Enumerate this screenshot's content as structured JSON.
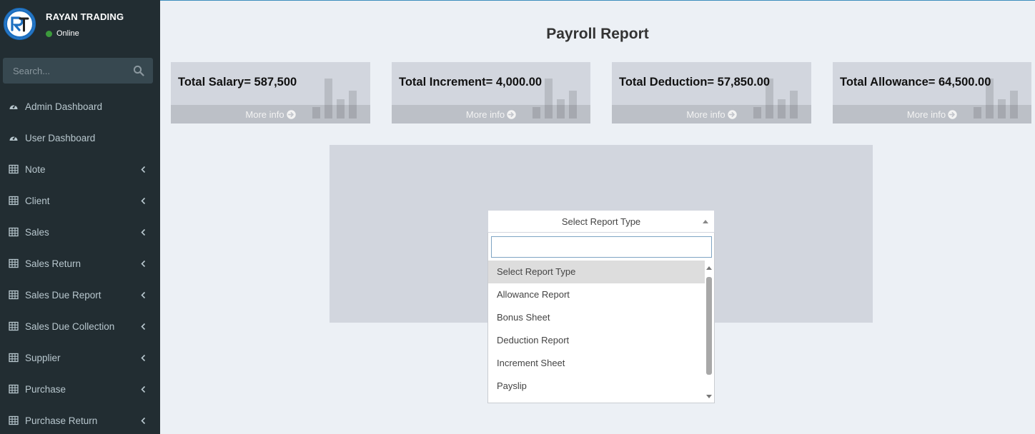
{
  "sidebar": {
    "brand": "RAYAN TRADING",
    "status": "Online",
    "search_placeholder": "Search...",
    "items": [
      {
        "label": "Admin Dashboard",
        "icon": "dashboard-icon",
        "has_children": false
      },
      {
        "label": "User Dashboard",
        "icon": "dashboard-icon",
        "has_children": false
      },
      {
        "label": "Note",
        "icon": "table-icon",
        "has_children": true
      },
      {
        "label": "Client",
        "icon": "table-icon",
        "has_children": true
      },
      {
        "label": "Sales",
        "icon": "table-icon",
        "has_children": true
      },
      {
        "label": "Sales Return",
        "icon": "table-icon",
        "has_children": true
      },
      {
        "label": "Sales Due Report",
        "icon": "table-icon",
        "has_children": true
      },
      {
        "label": "Sales Due Collection",
        "icon": "table-icon",
        "has_children": true
      },
      {
        "label": "Supplier",
        "icon": "table-icon",
        "has_children": true
      },
      {
        "label": "Purchase",
        "icon": "table-icon",
        "has_children": true
      },
      {
        "label": "Purchase Return",
        "icon": "table-icon",
        "has_children": true
      }
    ]
  },
  "page": {
    "title": "Payroll Report"
  },
  "stat_boxes": [
    {
      "text": "Total Salary= 587,500",
      "footer": "More info"
    },
    {
      "text": "Total Increment= 4,000.00",
      "footer": "More info"
    },
    {
      "text": "Total Deduction= 57,850.00",
      "footer": "More info"
    },
    {
      "text": "Total Allowance= 64,500.00",
      "footer": "More info"
    }
  ],
  "report_select": {
    "selected": "Select Report Type",
    "search_value": "",
    "options": [
      "Select Report Type",
      "Allowance Report",
      "Bonus Sheet",
      "Deduction Report",
      "Increment Sheet",
      "Payslip"
    ],
    "highlighted_index": 0
  },
  "colors": {
    "sidebar_bg": "#222d32",
    "content_bg": "#ecf0f5",
    "box_bg": "#d2d6de",
    "status_online": "#3c9a3c",
    "accent": "#3c8dbc"
  }
}
